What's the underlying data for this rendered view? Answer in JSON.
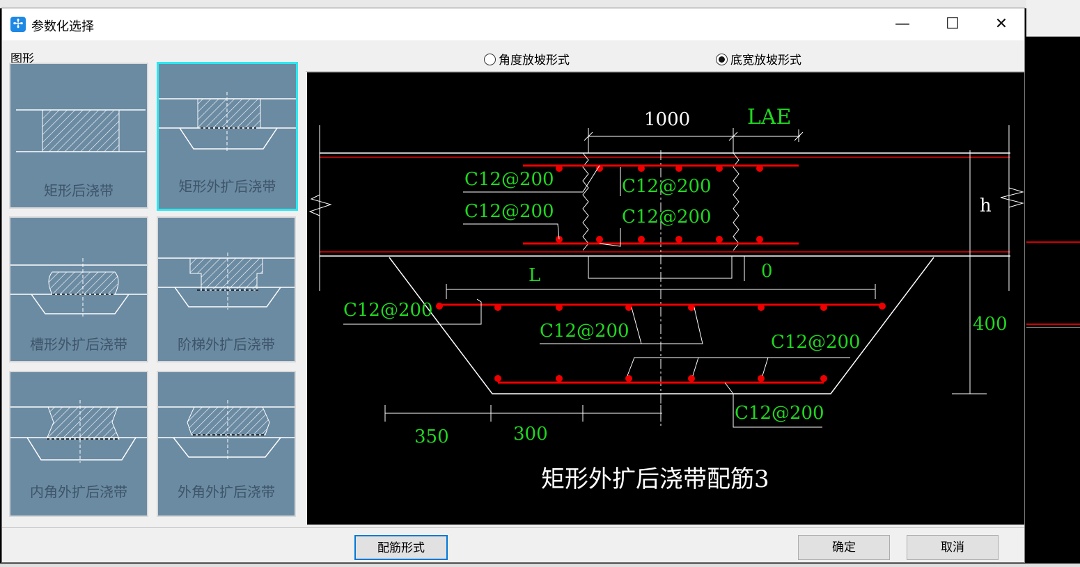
{
  "window": {
    "title": "参数化选择"
  },
  "left_panel": {
    "group_label": "图形",
    "items": [
      {
        "label": "矩形后浇带"
      },
      {
        "label": "矩形外扩后浇带"
      },
      {
        "label": "槽形外扩后浇带"
      },
      {
        "label": "阶梯外扩后浇带"
      },
      {
        "label": "内角外扩后浇带"
      },
      {
        "label": "外角外扩后浇带"
      }
    ],
    "selected_index": 1
  },
  "slope_options": [
    {
      "label": "角度放坡形式",
      "checked": false
    },
    {
      "label": "底宽放坡形式",
      "checked": true
    }
  ],
  "drawing": {
    "dim_top": "1000",
    "lae": "LAE",
    "h": "h",
    "zero": "0",
    "L": "L",
    "depth": "400",
    "rebar_1": "C12@200",
    "rebar_2": "C12@200",
    "rebar_3": "C12@200",
    "rebar_4": "C12@200",
    "rebar_5": "C12@200",
    "rebar_6": "C12@200",
    "rebar_7": "C12@200",
    "rebar_8": "C12@200",
    "dim_350": "350",
    "dim_300": "300",
    "caption": "矩形外扩后浇带配筋3"
  },
  "buttons": {
    "rebar_form": "配筋形式",
    "ok": "确定",
    "cancel": "取消"
  }
}
